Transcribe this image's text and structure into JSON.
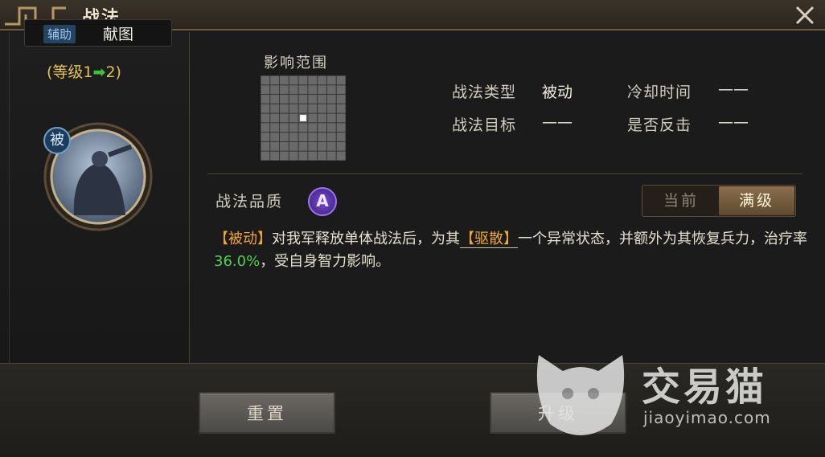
{
  "window": {
    "title": "战法"
  },
  "left": {
    "tab_support": "辅助",
    "tab_map": "献图",
    "level_prefix": "(等级1",
    "level_arrow": "➡",
    "level_suffix": "2)",
    "passive_badge": "被"
  },
  "range": {
    "label": "影响范围",
    "grid_size": 9,
    "highlight_cell": [
      4,
      4
    ]
  },
  "attributes": {
    "type_label": "战法类型",
    "type_value": "被动",
    "cooldown_label": "冷却时间",
    "cooldown_value": "——",
    "target_label": "战法目标",
    "target_value": "——",
    "counter_label": "是否反击",
    "counter_value": "——"
  },
  "quality": {
    "label": "战法品质",
    "grade": "A"
  },
  "toggle": {
    "current": "当前",
    "max": "满级"
  },
  "description": {
    "tag": "【被动】",
    "part1": "对我军释放单体战法后，为其",
    "disperse": "【驱散】",
    "part2": "一个异常状态，并额外为其恢复兵力，治疗率",
    "rate": "36.0%",
    "part3": "，受自身智力影响。"
  },
  "buttons": {
    "reset": "重置",
    "upgrade": "升级"
  },
  "watermark": {
    "cn": "交易猫",
    "en": "jiaoyimao.com"
  },
  "colors": {
    "accent_orange": "#f0a637",
    "rate_green": "#4fd14f",
    "quality_purple": "#7a4ad6",
    "level_gold": "#e3c055"
  }
}
